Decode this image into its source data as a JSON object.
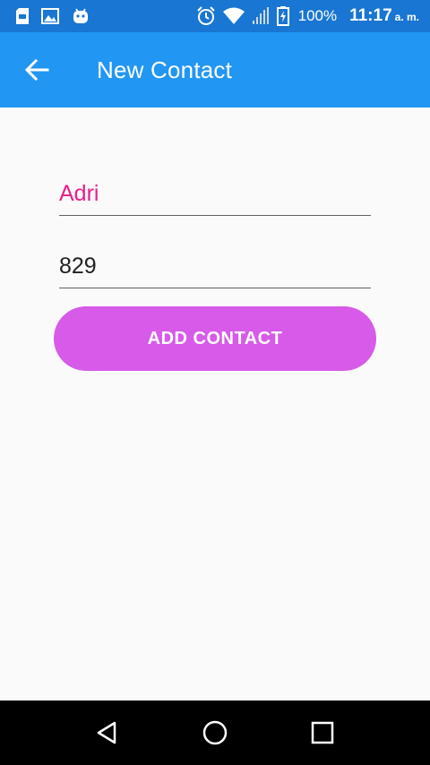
{
  "status_bar": {
    "battery_percent": "100%",
    "time": "11:17",
    "time_suffix": "a. m.",
    "icons": [
      "sd-card-icon",
      "image-icon",
      "android-icon",
      "alarm-icon",
      "wifi-icon",
      "signal-icon",
      "battery-charging-icon"
    ]
  },
  "app_bar": {
    "title": "New Contact",
    "back_icon": "arrow-left-icon",
    "background": "#2196f3"
  },
  "form": {
    "name_value": "Adri",
    "name_color": "#e91e8c",
    "phone_value": "829",
    "add_button_label": "ADD CONTACT",
    "add_button_color": "#d75ae8"
  },
  "nav_bar": {
    "buttons": [
      "back-triangle-icon",
      "home-circle-icon",
      "recents-square-icon"
    ]
  }
}
